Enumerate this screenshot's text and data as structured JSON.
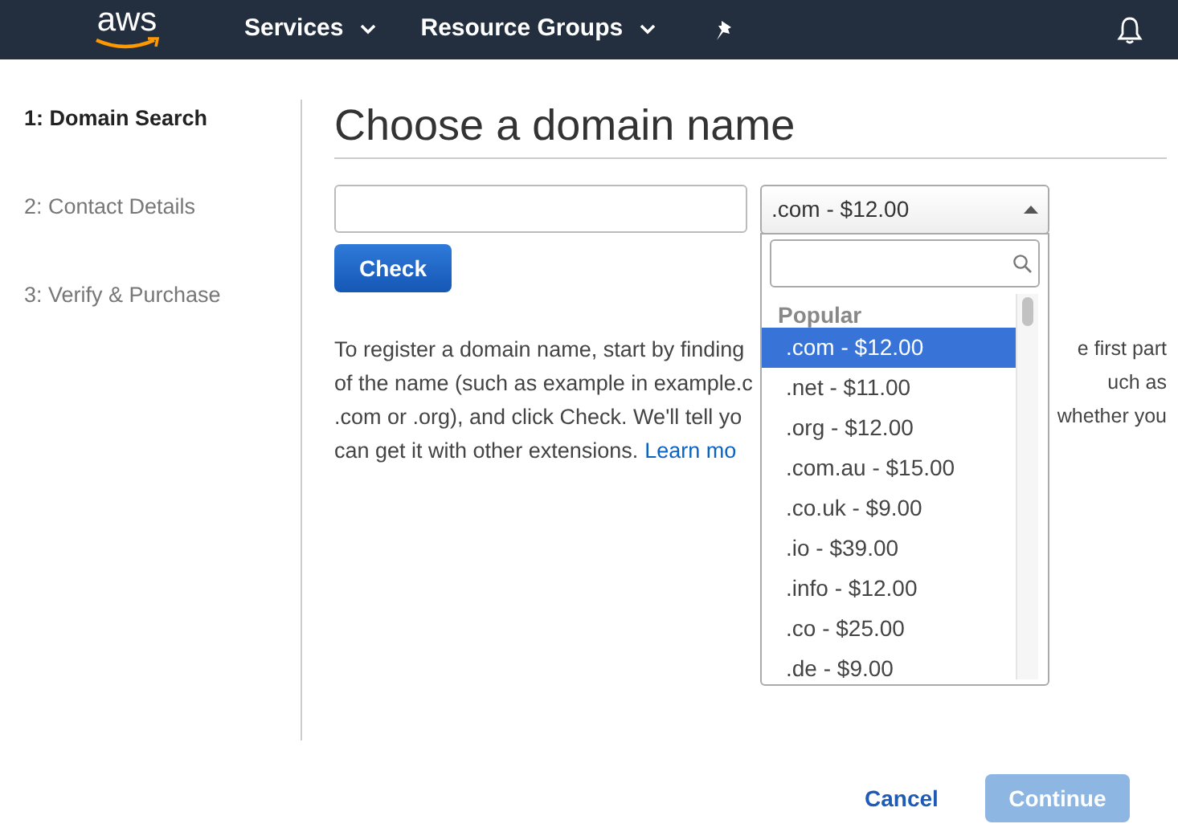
{
  "header": {
    "logo": "aws",
    "menus": [
      {
        "label": "Services"
      },
      {
        "label": "Resource Groups"
      }
    ]
  },
  "steps": [
    {
      "label": "1: Domain Search",
      "selected": true
    },
    {
      "label": "2: Contact Details",
      "selected": false
    },
    {
      "label": "3: Verify & Purchase",
      "selected": false
    }
  ],
  "title": "Choose a domain name",
  "extension_select": {
    "value": ".com - $12.00",
    "expanded": true,
    "group": "Popular",
    "options": [
      {
        "label": ".com - $12.00",
        "selected": true
      },
      {
        "label": ".net - $11.00",
        "selected": false
      },
      {
        "label": ".org - $12.00",
        "selected": false
      },
      {
        "label": ".com.au - $15.00",
        "selected": false
      },
      {
        "label": ".co.uk - $9.00",
        "selected": false
      },
      {
        "label": ".io - $39.00",
        "selected": false
      },
      {
        "label": ".info - $12.00",
        "selected": false
      },
      {
        "label": ".co - $25.00",
        "selected": false
      },
      {
        "label": ".de - $9.00",
        "selected": false
      }
    ]
  },
  "check_button": "Check",
  "description_lines": [
    {
      "left": "To register a domain name, start by finding",
      "right": "e first part"
    },
    {
      "left": "of the name (such as example in example.c",
      "right": "uch as"
    },
    {
      "left": ".com or .org), and click Check. We'll tell yo",
      "right": "whether you"
    },
    {
      "left": "can get it with other extensions.",
      "link": "Learn mo"
    }
  ],
  "footer": {
    "cancel": "Cancel",
    "continue": {
      "label": "Continue",
      "disabled": true
    }
  }
}
